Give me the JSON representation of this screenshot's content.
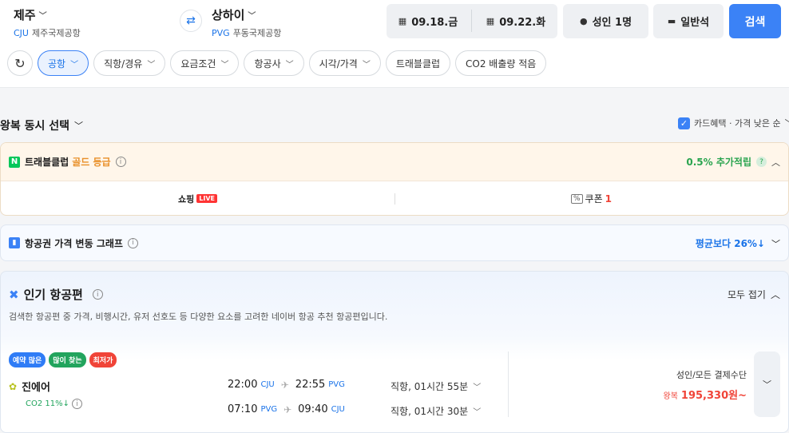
{
  "search": {
    "origin": {
      "name": "제주",
      "code": "CJU",
      "airport": "제주국제공항"
    },
    "destination": {
      "name": "상하이",
      "code": "PVG",
      "airport": "푸동국제공항"
    },
    "depart_date": "09.18.금",
    "return_date": "09.22.화",
    "passengers": "성인 1명",
    "seat_class": "일반석",
    "search_label": "검색"
  },
  "filters": [
    "공항",
    "직항/경유",
    "요금조건",
    "항공사",
    "시각/가격",
    "트래블클럽",
    "CO2 배출량 적음"
  ],
  "section": {
    "title": "왕복 동시 선택",
    "sort_label": "카드혜택 · 가격 낮은 순"
  },
  "club": {
    "title": "트래블클럽",
    "grade": "골드 등급",
    "point": "0.5% 추가적립",
    "shopping": "쇼핑",
    "live": "LIVE",
    "coupon_label": "쿠폰",
    "coupon_count": "1"
  },
  "graph": {
    "title": "항공권 가격 변동 그래프",
    "avg": "평균보다 26%↓"
  },
  "popular": {
    "title": "인기 항공편",
    "collapse": "모두 접기",
    "desc": "검색한 항공편 중 가격, 비행시간, 유저 선호도 등 다양한 요소를 고려한 네이버 항공 추천 항공편입니다.",
    "tags": [
      "예약 많은",
      "많이 찾는",
      "최저가"
    ],
    "airline": "진에어",
    "co2": "CO2 11%↓",
    "legs": [
      {
        "dep_time": "22:00",
        "dep_code": "CJU",
        "arr_time": "22:55",
        "arr_code": "PVG",
        "duration": "직항, 01시간 55분"
      },
      {
        "dep_time": "07:10",
        "dep_code": "PVG",
        "arr_time": "09:40",
        "arr_code": "CJU",
        "duration": "직항, 01시간 30분"
      }
    ],
    "price_label": "성인/모든 결제수단",
    "price_type": "왕복",
    "price": "195,330원~"
  }
}
